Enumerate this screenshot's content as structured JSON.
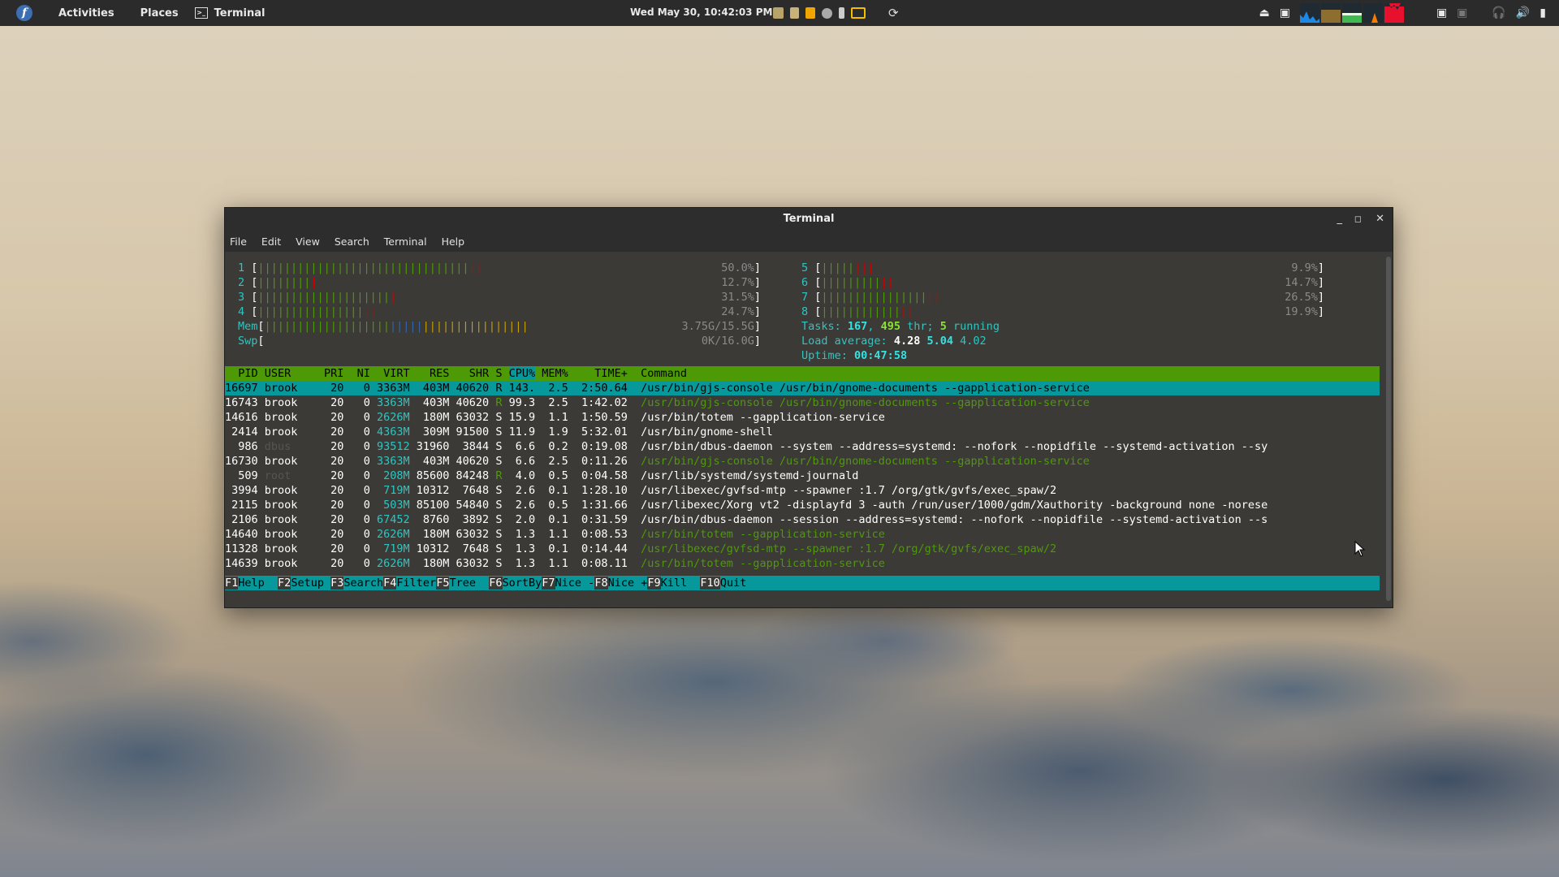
{
  "topbar": {
    "logo": "f",
    "activities": "Activities",
    "places": "Places",
    "app": "Terminal",
    "clock": "Wed May 30, 10:42:03 PM"
  },
  "window": {
    "title": "Terminal",
    "menu": [
      "File",
      "Edit",
      "View",
      "Search",
      "Terminal",
      "Help"
    ]
  },
  "htop": {
    "cpus_left": [
      {
        "num": "1",
        "bars": "||||||||||||||||||||||||||||||||",
        "red": "||",
        "pct": "50.0%"
      },
      {
        "num": "2",
        "bars": "||||||||",
        "red": "|",
        "pct": "12.7%"
      },
      {
        "num": "3",
        "bars": "||||||||||||||||||||",
        "red": "|",
        "pct": "31.5%"
      },
      {
        "num": "4",
        "bars": "||||||||||||||||",
        "red": "||",
        "pct": "24.7%"
      }
    ],
    "cpus_right": [
      {
        "num": "5",
        "bars": "|||||",
        "red": "|||",
        "pct": "9.9%"
      },
      {
        "num": "6",
        "bars": "|||||||||",
        "red": "||",
        "pct": "14.7%"
      },
      {
        "num": "7",
        "bars": "||||||||||||||||",
        "red": "||",
        "pct": "26.5%"
      },
      {
        "num": "8",
        "bars": "||||||||||||",
        "red": "||",
        "pct": "19.9%"
      }
    ],
    "mem": {
      "label": "Mem",
      "green": "|||||||||||||||||||",
      "blue": "|||||",
      "yellow": "||||||||||||||||",
      "value": "3.75G/15.5G"
    },
    "swp": {
      "label": "Swp",
      "value": "0K/16.0G"
    },
    "tasks": {
      "label": "Tasks:",
      "count": "167",
      "thr": "495",
      "thr_label": "thr;",
      "running": "5",
      "running_label": "running"
    },
    "load": {
      "label": "Load average:",
      "v1": "4.28",
      "v2": "5.04",
      "v3": "4.02"
    },
    "uptime": {
      "label": "Uptime:",
      "value": "00:47:58"
    },
    "header": {
      "pid": "PID",
      "user": "USER",
      "pri": "PRI",
      "ni": "NI",
      "virt": "VIRT",
      "res": "RES",
      "shr": "SHR",
      "s": "S",
      "cpu": "CPU%",
      "mem": "MEM%",
      "time": "TIME+",
      "cmd": "Command"
    },
    "processes": [
      {
        "pid": "16697",
        "user": "brook",
        "pri": "20",
        "ni": "0",
        "virt": "3363M",
        "res": "403M",
        "shr": "40620",
        "s": "R",
        "cpu": "143.",
        "mem": "2.5",
        "time": "2:50.64",
        "cmd": "/usr/bin/gjs-console /usr/bin/gnome-documents --gapplication-service"
      },
      {
        "pid": "16743",
        "user": "brook",
        "pri": "20",
        "ni": "0",
        "virt": "3363M",
        "res": "403M",
        "shr": "40620",
        "s": "R",
        "cpu": "99.3",
        "mem": "2.5",
        "time": "1:42.02",
        "cmd": "/usr/bin/gjs-console /usr/bin/gnome-documents --gapplication-service"
      },
      {
        "pid": "14616",
        "user": "brook",
        "pri": "20",
        "ni": "0",
        "virt": "2626M",
        "res": "180M",
        "shr": "63032",
        "s": "S",
        "cpu": "15.9",
        "mem": "1.1",
        "time": "1:50.59",
        "cmd": "/usr/bin/totem --gapplication-service"
      },
      {
        "pid": "2414",
        "user": "brook",
        "pri": "20",
        "ni": "0",
        "virt": "4363M",
        "res": "309M",
        "shr": "91500",
        "s": "S",
        "cpu": "11.9",
        "mem": "1.9",
        "time": "5:32.01",
        "cmd": "/usr/bin/gnome-shell"
      },
      {
        "pid": "986",
        "user": "dbus",
        "pri": "20",
        "ni": "0",
        "virt": "93512",
        "res": "31960",
        "shr": "3844",
        "s": "S",
        "cpu": "6.6",
        "mem": "0.2",
        "time": "0:19.08",
        "cmd": "/usr/bin/dbus-daemon --system --address=systemd: --nofork --nopidfile --systemd-activation --sy"
      },
      {
        "pid": "16730",
        "user": "brook",
        "pri": "20",
        "ni": "0",
        "virt": "3363M",
        "res": "403M",
        "shr": "40620",
        "s": "S",
        "cpu": "6.6",
        "mem": "2.5",
        "time": "0:11.26",
        "cmd": "/usr/bin/gjs-console /usr/bin/gnome-documents --gapplication-service"
      },
      {
        "pid": "509",
        "user": "root",
        "pri": "20",
        "ni": "0",
        "virt": "208M",
        "res": "85600",
        "shr": "84248",
        "s": "R",
        "cpu": "4.0",
        "mem": "0.5",
        "time": "0:04.58",
        "cmd": "/usr/lib/systemd/systemd-journald"
      },
      {
        "pid": "3994",
        "user": "brook",
        "pri": "20",
        "ni": "0",
        "virt": "719M",
        "res": "10312",
        "shr": "7648",
        "s": "S",
        "cpu": "2.6",
        "mem": "0.1",
        "time": "1:28.10",
        "cmd": "/usr/libexec/gvfsd-mtp --spawner :1.7 /org/gtk/gvfs/exec_spaw/2"
      },
      {
        "pid": "2115",
        "user": "brook",
        "pri": "20",
        "ni": "0",
        "virt": "503M",
        "res": "85100",
        "shr": "54840",
        "s": "S",
        "cpu": "2.6",
        "mem": "0.5",
        "time": "1:31.66",
        "cmd": "/usr/libexec/Xorg vt2 -displayfd 3 -auth /run/user/1000/gdm/Xauthority -background none -norese"
      },
      {
        "pid": "2106",
        "user": "brook",
        "pri": "20",
        "ni": "0",
        "virt": "67452",
        "res": "8760",
        "shr": "3892",
        "s": "S",
        "cpu": "2.0",
        "mem": "0.1",
        "time": "0:31.59",
        "cmd": "/usr/bin/dbus-daemon --session --address=systemd: --nofork --nopidfile --systemd-activation --s"
      },
      {
        "pid": "14640",
        "user": "brook",
        "pri": "20",
        "ni": "0",
        "virt": "2626M",
        "res": "180M",
        "shr": "63032",
        "s": "S",
        "cpu": "1.3",
        "mem": "1.1",
        "time": "0:08.53",
        "cmd": "/usr/bin/totem --gapplication-service"
      },
      {
        "pid": "11328",
        "user": "brook",
        "pri": "20",
        "ni": "0",
        "virt": "719M",
        "res": "10312",
        "shr": "7648",
        "s": "S",
        "cpu": "1.3",
        "mem": "0.1",
        "time": "0:14.44",
        "cmd": "/usr/libexec/gvfsd-mtp --spawner :1.7 /org/gtk/gvfs/exec_spaw/2"
      },
      {
        "pid": "14639",
        "user": "brook",
        "pri": "20",
        "ni": "0",
        "virt": "2626M",
        "res": "180M",
        "shr": "63032",
        "s": "S",
        "cpu": "1.3",
        "mem": "1.1",
        "time": "0:08.11",
        "cmd": "/usr/bin/totem --gapplication-service"
      }
    ],
    "fkeys": [
      {
        "key": "F1",
        "label": "Help  "
      },
      {
        "key": "F2",
        "label": "Setup "
      },
      {
        "key": "F3",
        "label": "Search"
      },
      {
        "key": "F4",
        "label": "Filter"
      },
      {
        "key": "F5",
        "label": "Tree  "
      },
      {
        "key": "F6",
        "label": "SortBy"
      },
      {
        "key": "F7",
        "label": "Nice -"
      },
      {
        "key": "F8",
        "label": "Nice +"
      },
      {
        "key": "F9",
        "label": "Kill  "
      },
      {
        "key": "F10",
        "label": "Quit"
      }
    ]
  },
  "colors": {
    "accent_teal": "#06989a",
    "accent_green": "#4e9a06"
  }
}
